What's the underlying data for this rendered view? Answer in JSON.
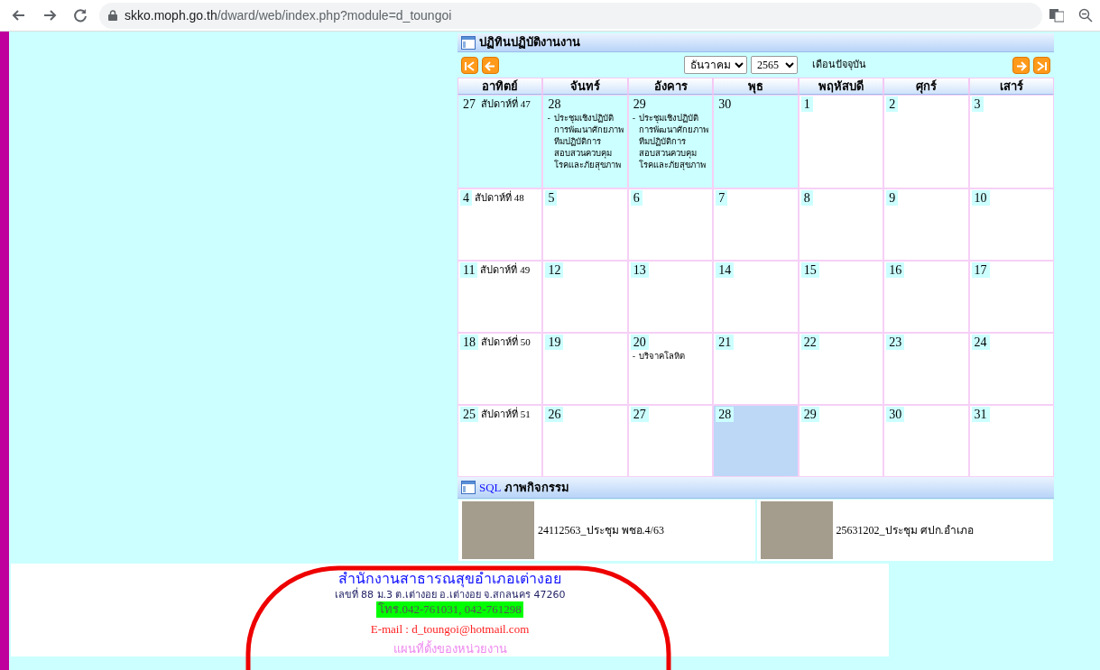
{
  "browser": {
    "url_host": "skko.moph.go.th",
    "url_path": "/dward/web/index.php?module=d_toungoi"
  },
  "calendar": {
    "title": "ปฏิทินปฏิบัติงานงาน",
    "month": "ธันวาคม",
    "year": "2565",
    "current_month_link": "เดือนปัจจุบัน",
    "weekdays": [
      "อาทิตย์",
      "จันทร์",
      "อังคาร",
      "พุธ",
      "พฤหัสบดี",
      "ศุกร์",
      "เสาร์"
    ],
    "weeks": [
      {
        "label": "สัปดาห์ที่",
        "number": "47",
        "days": [
          {
            "day": "27",
            "in_month": false,
            "selected": false
          },
          {
            "day": "28",
            "in_month": false,
            "selected": false,
            "events": [
              {
                "bullet": "-",
                "text": "ประชุมเชิงปฏิบัติการพัฒนาศักยภาพทีมปฏิบัติการสอบสวนควบคุมโรคและภัยสุขภาพ"
              }
            ]
          },
          {
            "day": "29",
            "in_month": false,
            "selected": false,
            "events": [
              {
                "bullet": "-",
                "text": "ประชุมเชิงปฏิบัติการพัฒนาศักยภาพทีมปฏิบัติการสอบสวนควบคุมโรคและภัยสุขภาพ"
              }
            ]
          },
          {
            "day": "30",
            "in_month": false,
            "selected": false
          },
          {
            "day": "1",
            "in_month": true,
            "selected": false
          },
          {
            "day": "2",
            "in_month": true,
            "selected": false
          },
          {
            "day": "3",
            "in_month": true,
            "selected": false
          }
        ]
      },
      {
        "label": "สัปดาห์ที่",
        "number": "48",
        "days": [
          {
            "day": "4",
            "in_month": true,
            "selected": false
          },
          {
            "day": "5",
            "in_month": true,
            "selected": false
          },
          {
            "day": "6",
            "in_month": true,
            "selected": false
          },
          {
            "day": "7",
            "in_month": true,
            "selected": false
          },
          {
            "day": "8",
            "in_month": true,
            "selected": false
          },
          {
            "day": "9",
            "in_month": true,
            "selected": false
          },
          {
            "day": "10",
            "in_month": true,
            "selected": false
          }
        ]
      },
      {
        "label": "สัปดาห์ที่",
        "number": "49",
        "days": [
          {
            "day": "11",
            "in_month": true,
            "selected": false
          },
          {
            "day": "12",
            "in_month": true,
            "selected": false
          },
          {
            "day": "13",
            "in_month": true,
            "selected": false
          },
          {
            "day": "14",
            "in_month": true,
            "selected": false
          },
          {
            "day": "15",
            "in_month": true,
            "selected": false
          },
          {
            "day": "16",
            "in_month": true,
            "selected": false
          },
          {
            "day": "17",
            "in_month": true,
            "selected": false
          }
        ]
      },
      {
        "label": "สัปดาห์ที่",
        "number": "50",
        "days": [
          {
            "day": "18",
            "in_month": true,
            "selected": false
          },
          {
            "day": "19",
            "in_month": true,
            "selected": false
          },
          {
            "day": "20",
            "in_month": true,
            "selected": false,
            "events": [
              {
                "bullet": "-",
                "text": "บริจาคโลหิต"
              }
            ]
          },
          {
            "day": "21",
            "in_month": true,
            "selected": false
          },
          {
            "day": "22",
            "in_month": true,
            "selected": false
          },
          {
            "day": "23",
            "in_month": true,
            "selected": false
          },
          {
            "day": "24",
            "in_month": true,
            "selected": false
          }
        ]
      },
      {
        "label": "สัปดาห์ที่",
        "number": "51",
        "days": [
          {
            "day": "25",
            "in_month": true,
            "selected": false
          },
          {
            "day": "26",
            "in_month": true,
            "selected": false
          },
          {
            "day": "27",
            "in_month": true,
            "selected": false
          },
          {
            "day": "28",
            "in_month": true,
            "selected": true
          },
          {
            "day": "29",
            "in_month": true,
            "selected": false
          },
          {
            "day": "30",
            "in_month": true,
            "selected": false
          },
          {
            "day": "31",
            "in_month": true,
            "selected": false
          }
        ]
      }
    ]
  },
  "activities": {
    "title_prefix": "SQL",
    "title": "ภาพกิจกรรม",
    "items": [
      {
        "caption": "24112563_ประชุม พชอ.4/63"
      },
      {
        "caption": "25631202_ประชุม ศปก.อำเภอ"
      }
    ]
  },
  "footer": {
    "org": "สำนักงานสาธารณสุขอำเภอเต่างอย",
    "address": "เลขที่ 88 ม.3 ต.เต่างอย อ.เต่างอย จ.สกลนคร 47260",
    "phone": "โทร.042-761031, 042-761298",
    "email": "E-mail : d_toungoi@hotmail.com",
    "map_link": "แผนที่ตั้งของหน่วยงาน"
  }
}
